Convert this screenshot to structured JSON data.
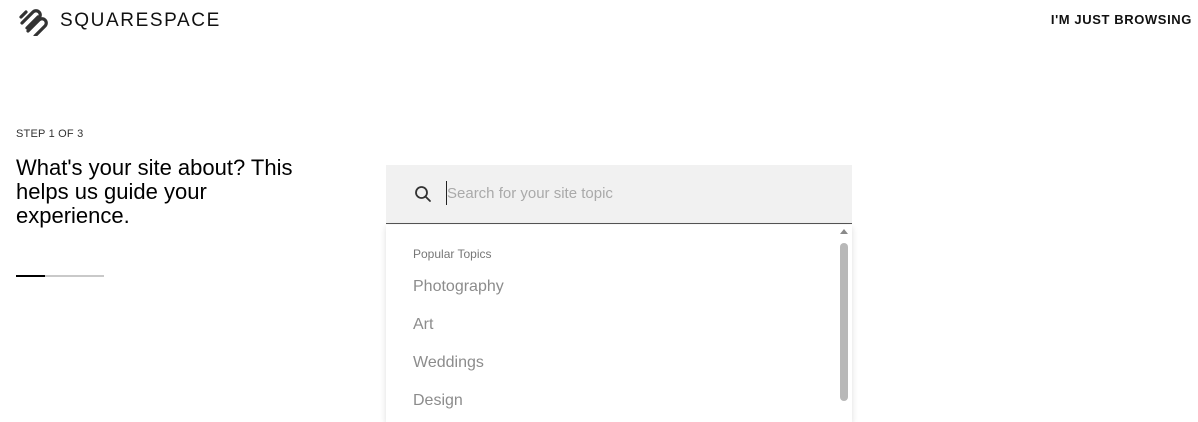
{
  "header": {
    "brand": "SQUARESPACE",
    "logo_icon": "squarespace-logo-icon",
    "browse_link": "I'M JUST BROWSING"
  },
  "intro": {
    "step": "STEP 1 OF 3",
    "headline": "What's your site about? This helps us guide your experience.",
    "progress": 0.33
  },
  "search": {
    "icon": "search-icon",
    "placeholder": "Search for your site topic",
    "value": ""
  },
  "dropdown": {
    "heading": "Popular Topics",
    "items": [
      "Photography",
      "Art",
      "Weddings",
      "Design"
    ]
  },
  "colors": {
    "search_bg": "#f1f1f1",
    "item_text": "#8c8c8c",
    "progress_track": "#c9c9c9",
    "progress_fill": "#000000"
  }
}
